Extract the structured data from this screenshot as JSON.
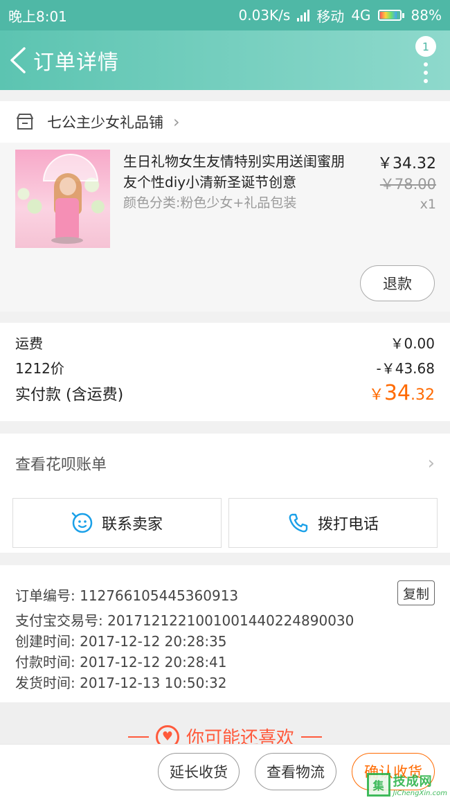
{
  "status_bar": {
    "time": "晚上8:01",
    "speed": "0.03K/s",
    "carrier": "移动",
    "network": "4G",
    "battery": "88%"
  },
  "header": {
    "title": "订单详情",
    "badge_count": "1"
  },
  "shop": {
    "name": "七公主少女礼品铺"
  },
  "product": {
    "title": "生日礼物女生友情特别实用送闺蜜朋友个性diy小清新圣诞节创意",
    "sku": "颜色分类:粉色少女+礼品包装",
    "price": "￥34.32",
    "original_price": "￥78.00",
    "quantity": "x1",
    "refund_label": "退款"
  },
  "fees": {
    "shipping_label": "运费",
    "shipping_value": "￥0.00",
    "discount_label": "1212价",
    "discount_value": "-￥43.68",
    "paid_label": "实付款 (含运费)",
    "paid_currency": "￥",
    "paid_integer": "34",
    "paid_decimal": ".32"
  },
  "huabei": {
    "label": "查看花呗账单"
  },
  "contact": {
    "seller_label": "联系卖家",
    "phone_label": "拨打电话"
  },
  "order_info": {
    "order_no": "订单编号: 112766105445360913",
    "alipay_no": "支付宝交易号: 2017121221001001440224890030",
    "created": "创建时间: 2017-12-12 20:28:35",
    "paid": "付款时间: 2017-12-12 20:28:41",
    "shipped": "发货时间: 2017-12-13 10:50:32",
    "copy_label": "复制"
  },
  "recommend": {
    "title": "你可能还喜欢"
  },
  "bottom_bar": {
    "extend_label": "延长收货",
    "logistics_label": "查看物流",
    "confirm_label": "确认收货"
  },
  "watermark": {
    "cn": "技成网",
    "en": "JiChengXin.com"
  },
  "colors": {
    "accent": "#4fb8a6",
    "price_highlight": "#ff6a00"
  }
}
